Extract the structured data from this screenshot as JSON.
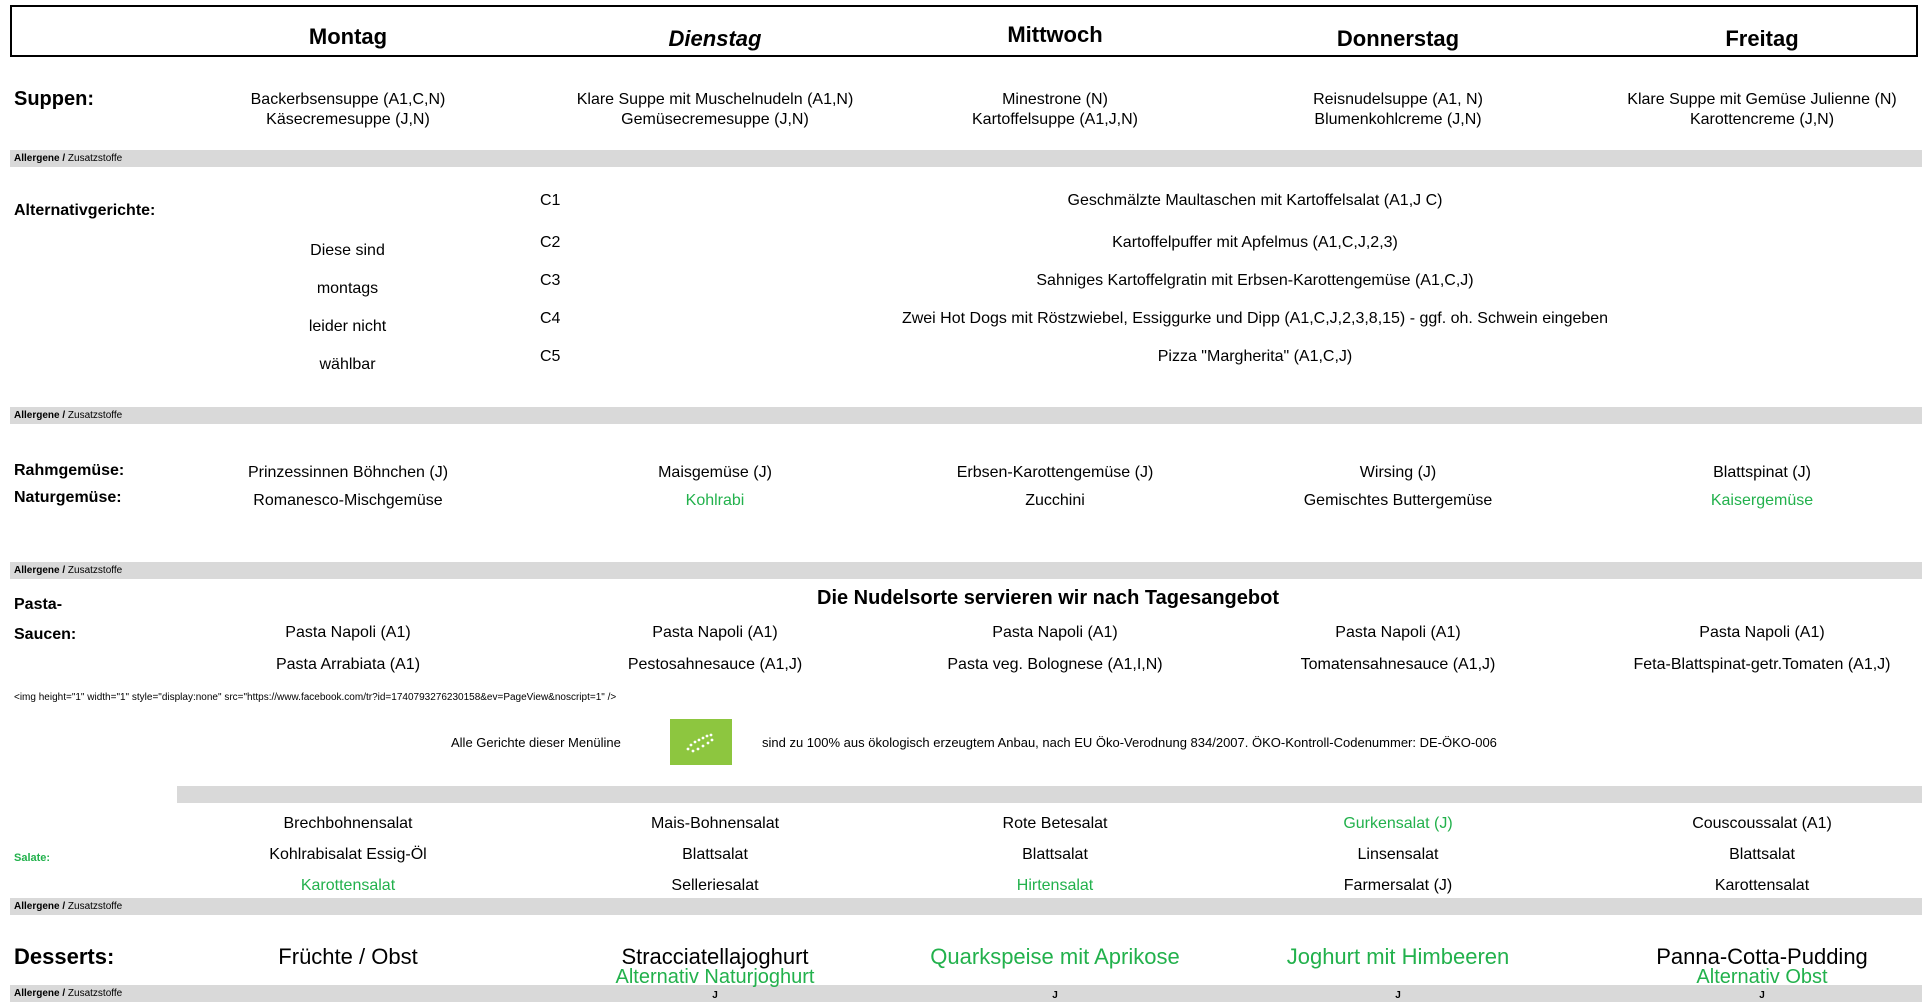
{
  "days": [
    "Montag",
    "Dienstag",
    "Mittwoch",
    "Donnerstag",
    "Freitag"
  ],
  "sections": {
    "soups_label": "Suppen:",
    "alternatives_label": "Alternativgerichte:",
    "cream_veg_label": "Rahmgemüse:",
    "natural_veg_label": "Naturgemüse:",
    "pasta_label_1": "Pasta-",
    "pasta_label_2": "Saucen:",
    "salads_label": "Salate:",
    "desserts_label": "Desserts:"
  },
  "allergen_bar": {
    "bold": "Allergene /",
    "normal": "Zusatzstoffe"
  },
  "soups": [
    [
      "Backerbsensuppe (A1,C,N)",
      "Käsecremesuppe (J,N)"
    ],
    [
      "Klare Suppe mit Muschelnudeln (A1,N)",
      "Gemüsecremesuppe (J,N)"
    ],
    [
      "Minestrone (N)",
      "Kartoffelsuppe (A1,J,N)"
    ],
    [
      "Reisnudelsuppe (A1, N)",
      "Blumenkohlcreme (J,N)"
    ],
    [
      "Klare Suppe mit Gemüse Julienne (N)",
      "Karottencreme (J,N)"
    ]
  ],
  "alternatives": {
    "note": [
      "Diese sind",
      "montags",
      "leider nicht",
      "wählbar"
    ],
    "items": [
      {
        "code": "C1",
        "text": "Geschmälzte Maultaschen mit Kartoffelsalat (A1,J C)"
      },
      {
        "code": "C2",
        "text": "Kartoffelpuffer mit Apfelmus (A1,C,J,2,3)"
      },
      {
        "code": "C3",
        "text": "Sahniges Kartoffelgratin mit Erbsen-Karottengemüse (A1,C,J)"
      },
      {
        "code": "C4",
        "text": "Zwei Hot Dogs mit Röstzwiebel, Essiggurke und Dipp (A1,C,J,2,3,8,15) - ggf. oh. Schwein eingeben"
      },
      {
        "code": "C5",
        "text": "Pizza \"Margherita\" (A1,C,J)"
      }
    ]
  },
  "cream_veg": [
    "Prinzessinnen Böhnchen (J)",
    "Maisgemüse (J)",
    "Erbsen-Karottengemüse (J)",
    "Wirsing (J)",
    "Blattspinat (J)"
  ],
  "natural_veg": [
    "Romanesco-Mischgemüse",
    "Kohlrabi",
    "Zucchini",
    "Gemischtes Buttergemüse",
    "Kaisergemüse"
  ],
  "pasta": {
    "heading": "Die Nudelsorte servieren wir nach Tagesangebot",
    "row1": [
      "Pasta Napoli (A1)",
      "Pasta Napoli (A1)",
      "Pasta Napoli (A1)",
      "Pasta Napoli (A1)",
      "Pasta Napoli (A1)"
    ],
    "row2": [
      "Pasta Arrabiata (A1)",
      "Pestosahnesauce (A1,J)",
      "Pasta veg. Bolognese (A1,I,N)",
      "Tomatensahnesauce (A1,J)",
      "Feta-Blattspinat-getr.Tomaten (A1,J)"
    ]
  },
  "tracking_text": "<img height=\"1\" width=\"1\" style=\"display:none\" src=\"https://www.facebook.com/tr?id=1740793276230158&ev=PageView&noscript=1\" />",
  "eco": {
    "left_text": "Alle Gerichte dieser Menüline",
    "right_text": "sind zu 100% aus ökologisch erzeugtem Anbau, nach EU Öko-Verodnung 834/2007. ÖKO-Kontroll-Codenummer: DE-ÖKO-006",
    "logo_color": "#8dc63f"
  },
  "salads": [
    [
      "Brechbohnensalat",
      "Kohlrabisalat Essig-Öl",
      "Karottensalat"
    ],
    [
      "Mais-Bohnensalat",
      "Blattsalat",
      "Selleriesalat"
    ],
    [
      "Rote Betesalat",
      "Blattsalat",
      "Hirtensalat"
    ],
    [
      "Gurkensalat (J)",
      "Linsensalat",
      "Farmersalat (J)"
    ],
    [
      "Couscoussalat (A1)",
      "Blattsalat",
      "Karottensalat"
    ]
  ],
  "desserts": [
    "Früchte / Obst",
    "Stracciatellajoghurt",
    "Quarkspeise mit Aprikose",
    "Joghurt mit Himbeeren",
    "Panna-Cotta-Pudding"
  ],
  "dessert_alternatives": {
    "day2": "Alternativ Naturjoghurt",
    "day5": "Alternativ Obst"
  },
  "dessert_allergens": [
    "J",
    "J",
    "J",
    "J"
  ],
  "colors": {
    "eco_green": "#22b14c",
    "bar_gray": "#d9d9d9"
  }
}
